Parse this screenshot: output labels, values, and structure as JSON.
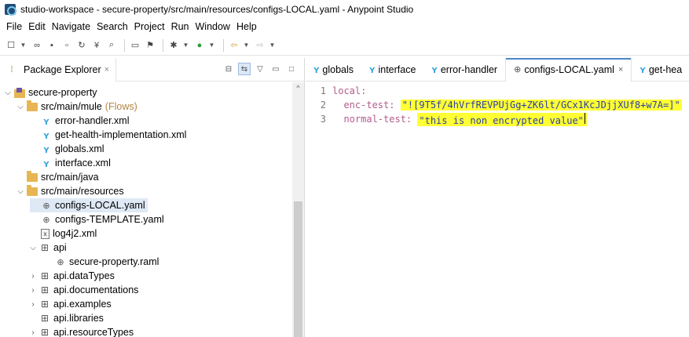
{
  "window": {
    "title": "studio-workspace - secure-property/src/main/resources/configs-LOCAL.yaml - Anypoint Studio"
  },
  "menu": [
    "File",
    "Edit",
    "Navigate",
    "Search",
    "Project",
    "Run",
    "Window",
    "Help"
  ],
  "package_explorer": {
    "tab_label": "Package Explorer",
    "tree": [
      {
        "label": "secure-property",
        "icon": "project-icon",
        "arrow": "v"
      },
      {
        "label": "src/main/mule",
        "suffix": "(Flows)",
        "icon": "folder-icon",
        "arrow": "v"
      },
      {
        "label": "error-handler.xml",
        "icon": "mule-icon",
        "arrow": ""
      },
      {
        "label": "get-health-implementation.xml",
        "icon": "mule-icon",
        "arrow": ""
      },
      {
        "label": "globals.xml",
        "icon": "mule-icon",
        "arrow": ""
      },
      {
        "label": "interface.xml",
        "icon": "mule-icon",
        "arrow": ""
      },
      {
        "label": "src/main/java",
        "icon": "folder-icon",
        "arrow": ""
      },
      {
        "label": "src/main/resources",
        "icon": "folder-icon",
        "arrow": "v"
      },
      {
        "label": "configs-LOCAL.yaml",
        "icon": "yaml-icon",
        "arrow": "",
        "selected": true
      },
      {
        "label": "configs-TEMPLATE.yaml",
        "icon": "yaml-icon",
        "arrow": ""
      },
      {
        "label": "log4j2.xml",
        "icon": "xml-icon",
        "arrow": ""
      },
      {
        "label": "api",
        "icon": "package-icon",
        "arrow": "v"
      },
      {
        "label": "secure-property.raml",
        "icon": "yaml-icon",
        "arrow": ""
      },
      {
        "label": "api.dataTypes",
        "icon": "package-icon",
        "arrow": ">"
      },
      {
        "label": "api.documentations",
        "icon": "package-icon",
        "arrow": ">"
      },
      {
        "label": "api.examples",
        "icon": "package-icon",
        "arrow": ">"
      },
      {
        "label": "api.libraries",
        "icon": "package-icon",
        "arrow": ""
      },
      {
        "label": "api.resourceTypes",
        "icon": "package-icon",
        "arrow": ">"
      }
    ]
  },
  "editor": {
    "tabs": [
      {
        "label": "globals",
        "icon": "mule-icon",
        "active": false
      },
      {
        "label": "interface",
        "icon": "mule-icon",
        "active": false
      },
      {
        "label": "error-handler",
        "icon": "mule-icon",
        "active": false
      },
      {
        "label": "configs-LOCAL.yaml",
        "icon": "yaml-icon",
        "active": true
      },
      {
        "label": "get-hea",
        "icon": "mule-icon",
        "active": false
      }
    ],
    "lines": [
      {
        "num": "1",
        "key": "local:",
        "value": ""
      },
      {
        "num": "2",
        "key": "  enc-test: ",
        "value": "\"![9T5f/4hVrfREVPUjGg+ZK6lt/GCx1KcJDjjXUf8+w7A=]\""
      },
      {
        "num": "3",
        "key": "  normal-test: ",
        "value": "\"this is non encrypted value\""
      }
    ],
    "highlight_color": "#ffff33"
  }
}
